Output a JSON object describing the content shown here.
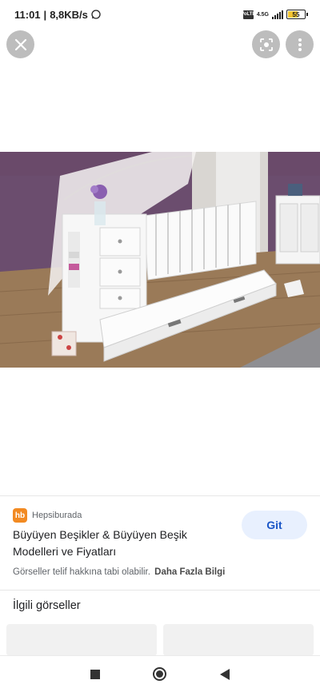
{
  "status_bar": {
    "time": "11:01",
    "network_speed": "8,8KB/s",
    "sim_label": "VoLTE",
    "network_type": "4.5G",
    "battery_level": "55"
  },
  "viewer": {
    "close_icon": "close-icon",
    "lens_icon": "google-lens-icon",
    "more_icon": "more-vert-icon"
  },
  "result": {
    "source_logo": "hb",
    "source_name": "Hepsiburada",
    "title": "Büyüyen Beşikler & Büyüyen Beşik Modelleri ve Fiyatları",
    "visit_button": "Git",
    "copyright_notice": "Görseller telif hakkına tabi olabilir.",
    "more_info_link": "Daha Fazla Bilgi"
  },
  "related": {
    "heading": "İlgili görseller"
  },
  "colors": {
    "accent_button_bg": "#e8f0fe",
    "accent_button_text": "#1a56c7",
    "source_logo_bg": "#f28a22"
  }
}
